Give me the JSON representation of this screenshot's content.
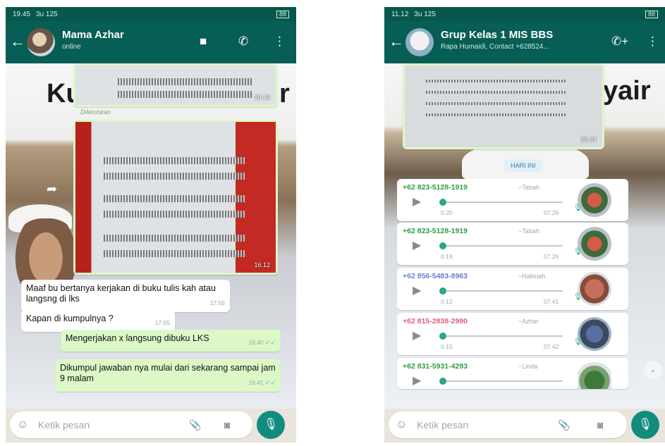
{
  "left": {
    "status_time": "19.45",
    "status_extra": "3u 125",
    "battery": "88",
    "header": {
      "title": "Mama Azhar",
      "subtitle": "online"
    },
    "bg_text": "Ku",
    "bg_text_right": "r",
    "images": [
      {
        "time": "16.12"
      },
      {
        "forwarded_label": "Diteruskan",
        "time": "16.12"
      }
    ],
    "messages": [
      {
        "text": "Maaf bu bertanya kerjakan di buku tulis kah atau langsng di lks",
        "time": "17.55"
      },
      {
        "text": "Kapan di kumpulnya ?",
        "time": "17.55"
      },
      {
        "text": "Mengerjakan x langsung dibuku LKS",
        "time": "19.40"
      },
      {
        "text": "Dikumpul jawaban nya mulai dari sekarang  sampai jam 9 malam",
        "time": "19.41"
      }
    ],
    "input_placeholder": "Ketik pesan"
  },
  "right": {
    "status_time": "11.12",
    "status_extra": "3u 125",
    "battery": "88",
    "header": {
      "title": "Grup Kelas 1 MIS BBS",
      "subtitle": "Rapa Humaidi, Contact +628524..."
    },
    "bg_text": "yair",
    "image_time": "20.34",
    "day_label": "HARI INI",
    "voice_notes": [
      {
        "sender": "+62 823-5128-1919",
        "alias": "~Tabah",
        "duration": "0:20",
        "time": "07.26",
        "color": "#2e9e44"
      },
      {
        "sender": "+62 823-5128-1919",
        "alias": "~Tabah",
        "duration": "0:19",
        "time": "07.26",
        "color": "#2e9e44"
      },
      {
        "sender": "+62 856-5483-8963",
        "alias": "~Halimah",
        "duration": "0:12",
        "time": "07.41",
        "color": "#6a7fd0"
      },
      {
        "sender": "+62 815-2838-2990",
        "alias": "~Azhar",
        "duration": "0:15",
        "time": "07.42",
        "color": "#e0607a"
      },
      {
        "sender": "+62 831-5931-4293",
        "alias": "~Linda",
        "duration": "",
        "time": "",
        "color": "#2e9e44"
      }
    ],
    "input_placeholder": "Ketik pesan"
  },
  "colors": {
    "header": "#075e54",
    "outgoing": "#dcf8c6",
    "accent": "#128c7e"
  },
  "icons": {
    "back": "←",
    "video": "■",
    "call": "✆",
    "menu": "⋮",
    "add_call": "✆+",
    "play": "▶",
    "mic": "🎙",
    "emoji": "☺",
    "clip": "📎",
    "camera": "◙",
    "share": "➦",
    "chevron": "⌄"
  }
}
